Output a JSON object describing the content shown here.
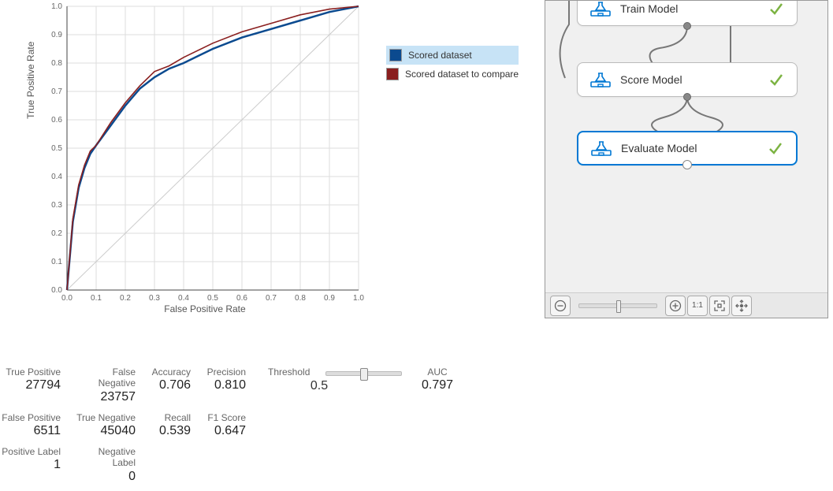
{
  "chart_data": {
    "type": "line",
    "title": "",
    "xlabel": "False Positive Rate",
    "ylabel": "True Positive Rate",
    "xlim": [
      0,
      1
    ],
    "ylim": [
      0,
      1
    ],
    "x_ticks": [
      "0.0",
      "0.1",
      "0.2",
      "0.3",
      "0.4",
      "0.5",
      "0.6",
      "0.7",
      "0.8",
      "0.9",
      "1.0"
    ],
    "y_ticks": [
      "0.0",
      "0.1",
      "0.2",
      "0.3",
      "0.4",
      "0.5",
      "0.6",
      "0.7",
      "0.8",
      "0.9",
      "1.0"
    ],
    "series": [
      {
        "name": "Scored dataset",
        "color": "#0b4a8f",
        "x": [
          0.0,
          0.02,
          0.04,
          0.06,
          0.08,
          0.1,
          0.15,
          0.2,
          0.25,
          0.3,
          0.35,
          0.4,
          0.5,
          0.6,
          0.7,
          0.8,
          0.9,
          1.0
        ],
        "y": [
          0.0,
          0.24,
          0.36,
          0.43,
          0.48,
          0.51,
          0.58,
          0.65,
          0.71,
          0.75,
          0.78,
          0.8,
          0.85,
          0.89,
          0.92,
          0.95,
          0.98,
          1.0
        ]
      },
      {
        "name": "Scored dataset to compare",
        "color": "#8a1f1f",
        "x": [
          0.0,
          0.02,
          0.04,
          0.06,
          0.08,
          0.1,
          0.15,
          0.2,
          0.25,
          0.3,
          0.35,
          0.4,
          0.5,
          0.6,
          0.7,
          0.8,
          0.9,
          1.0
        ],
        "y": [
          0.0,
          0.25,
          0.37,
          0.44,
          0.49,
          0.51,
          0.59,
          0.66,
          0.72,
          0.77,
          0.79,
          0.82,
          0.87,
          0.91,
          0.94,
          0.97,
          0.99,
          1.0
        ]
      }
    ],
    "reference_line": {
      "from": [
        0,
        0
      ],
      "to": [
        1,
        1
      ]
    }
  },
  "legend": {
    "items": [
      "Scored dataset",
      "Scored dataset to compare"
    ]
  },
  "metrics": {
    "tp": {
      "label": "True Positive",
      "value": "27794"
    },
    "fn": {
      "label": "False Negative",
      "value": "23757"
    },
    "accuracy": {
      "label": "Accuracy",
      "value": "0.706"
    },
    "precision": {
      "label": "Precision",
      "value": "0.810"
    },
    "fp": {
      "label": "False Positive",
      "value": "6511"
    },
    "tn": {
      "label": "True Negative",
      "value": "45040"
    },
    "recall": {
      "label": "Recall",
      "value": "0.539"
    },
    "f1": {
      "label": "F1 Score",
      "value": "0.647"
    },
    "pos": {
      "label": "Positive Label",
      "value": "1"
    },
    "neg": {
      "label": "Negative Label",
      "value": "0"
    },
    "threshold": {
      "label": "Threshold",
      "value": "0.5"
    },
    "auc": {
      "label": "AUC",
      "value": "0.797"
    }
  },
  "pipeline": {
    "nodes": [
      {
        "label": "Train Model",
        "status": "ok"
      },
      {
        "label": "Score Model",
        "status": "ok"
      },
      {
        "label": "Evaluate Model",
        "status": "ok",
        "selected": true
      }
    ]
  },
  "toolbar": {
    "zoom_out": "−",
    "zoom_in": "+",
    "actual": "1:1",
    "fit": "⤢",
    "pan": "✥"
  }
}
